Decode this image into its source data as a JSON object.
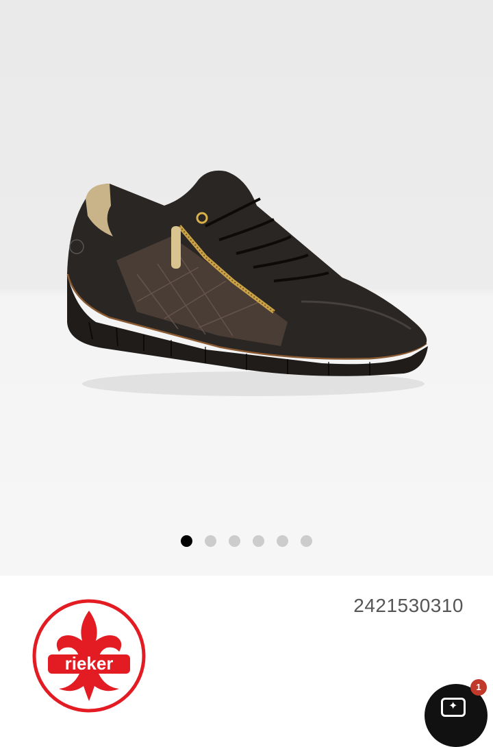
{
  "product": {
    "sku": "2421530310",
    "image_description_icon": "sneaker-product-image"
  },
  "gallery": {
    "total_images": 6,
    "active_index": 0
  },
  "brand": {
    "logo_text": "rieker",
    "color": "#e31b23"
  },
  "assistant": {
    "badge_count": "1",
    "icon": "chat-sparkle-icon"
  },
  "colors": {
    "dot_active": "#000000",
    "dot_inactive": "#cccccc",
    "fab": "#111111",
    "badge": "#c0392b"
  }
}
